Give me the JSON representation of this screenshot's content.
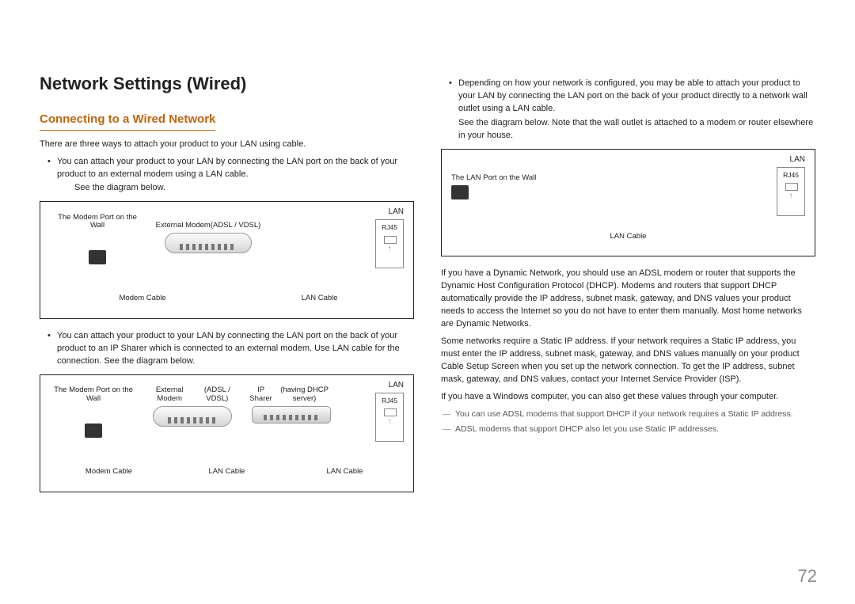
{
  "page_number": "72",
  "left": {
    "heading": "Network Settings (Wired)",
    "subheading": "Connecting to a Wired Network",
    "intro": "There are three ways to attach your product to your LAN using cable.",
    "bullet1": "You can attach your product to your LAN by connecting the LAN port on the back of your product to an external modem using a LAN cable.",
    "bullet1_sub": "See the diagram below.",
    "diagram1": {
      "wall": "The Modem Port on the Wall",
      "modem": "External Modem",
      "modem_sub": "(ADSL / VDSL)",
      "lan": "LAN",
      "rj45": "RJ45",
      "cable1": "Modem Cable",
      "cable2": "LAN Cable"
    },
    "bullet2": "You can attach your product to your LAN by connecting the LAN port on the back of your product to an IP Sharer which is connected to an external modem. Use LAN cable for the connection. See the diagram below.",
    "diagram2": {
      "wall": "The Modem Port on the Wall",
      "modem": "External Modem",
      "modem_sub": "(ADSL / VDSL)",
      "sharer": "IP Sharer",
      "sharer_sub": "(having DHCP server)",
      "lan": "LAN",
      "rj45": "RJ45",
      "cable1": "Modem Cable",
      "cable2": "LAN Cable",
      "cable3": "LAN Cable"
    }
  },
  "right": {
    "bullet3a": "Depending on how your network is configured, you may be able to attach your product to your LAN by connecting the LAN port on the back of your product directly to a network wall outlet using a LAN cable.",
    "bullet3b": "See the diagram below. Note that the wall outlet is attached to a modem or router elsewhere in your house.",
    "diagram3": {
      "wall": "The LAN Port on the Wall",
      "lan": "LAN",
      "rj45": "RJ45",
      "cable": "LAN Cable"
    },
    "p1": "If you have a Dynamic Network, you should use an ADSL modem or router that supports the Dynamic Host Configuration Protocol (DHCP). Modems and routers that support DHCP automatically provide the IP address, subnet mask, gateway, and DNS values your product needs to access the Internet so you do not have to enter them manually. Most home networks are Dynamic Networks.",
    "p2": "Some networks require a Static IP address. If your network requires a Static IP address, you must enter the IP address, subnet mask, gateway, and DNS values manually on your product Cable Setup Screen when you set up the network connection. To get the IP address, subnet mask, gateway, and DNS values, contact your Internet Service Provider (ISP).",
    "p3": "If you have a Windows computer, you can also get these values through your computer.",
    "note1": "You can use ADSL modems that support DHCP if your network requires a Static IP address.",
    "note2": "ADSL modems that support DHCP also let you use Static IP addresses."
  }
}
